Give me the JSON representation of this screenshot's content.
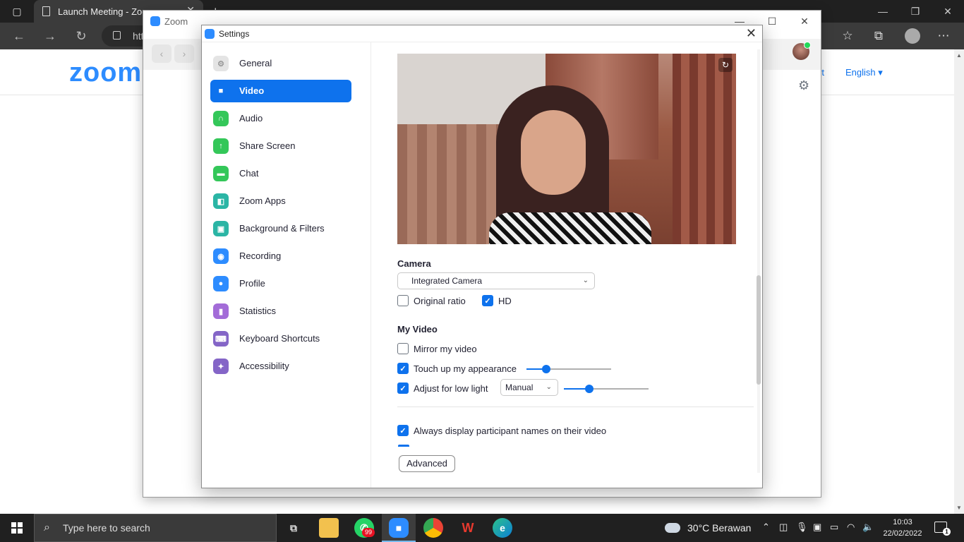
{
  "browser": {
    "tab_title": "Launch Meeting - Zoom",
    "address_text": "htt",
    "tab_close": "✕",
    "new_tab": "+"
  },
  "zoom_page": {
    "logo": "zoom",
    "support_link": "rt",
    "language_link": "English ▾"
  },
  "zoom_window": {
    "title": "Zoom",
    "nav_back": "‹",
    "nav_forward": "›"
  },
  "settings": {
    "title": "Settings",
    "close": "✕",
    "sidebar": [
      {
        "label": "General",
        "icon": "gear-icon",
        "color": "#e4e4e4",
        "glyph": "⚙",
        "active": false
      },
      {
        "label": "Video",
        "icon": "video-camera-icon",
        "color": "#0e72ed",
        "glyph": "■",
        "active": true
      },
      {
        "label": "Audio",
        "icon": "headphones-icon",
        "color": "#34c759",
        "glyph": "∩",
        "active": false
      },
      {
        "label": "Share Screen",
        "icon": "share-screen-icon",
        "color": "#34c759",
        "glyph": "↑",
        "active": false
      },
      {
        "label": "Chat",
        "icon": "chat-bubble-icon",
        "color": "#34c759",
        "glyph": "▬",
        "active": false
      },
      {
        "label": "Zoom Apps",
        "icon": "apps-icon",
        "color": "#2bb5a5",
        "glyph": "◧",
        "active": false
      },
      {
        "label": "Background & Filters",
        "icon": "background-icon",
        "color": "#2bb5a5",
        "glyph": "▣",
        "active": false
      },
      {
        "label": "Recording",
        "icon": "record-icon",
        "color": "#2d8cff",
        "glyph": "◉",
        "active": false
      },
      {
        "label": "Profile",
        "icon": "profile-icon",
        "color": "#2d8cff",
        "glyph": "●",
        "active": false
      },
      {
        "label": "Statistics",
        "icon": "statistics-icon",
        "color": "#a36cd8",
        "glyph": "▮",
        "active": false
      },
      {
        "label": "Keyboard Shortcuts",
        "icon": "keyboard-icon",
        "color": "#8465c7",
        "glyph": "⌨",
        "active": false
      },
      {
        "label": "Accessibility",
        "icon": "accessibility-icon",
        "color": "#8465c7",
        "glyph": "✦",
        "active": false
      }
    ],
    "camera_heading": "Camera",
    "camera_select": "Integrated Camera",
    "original_ratio": {
      "label": "Original ratio",
      "checked": false
    },
    "hd": {
      "label": "HD",
      "checked": true
    },
    "my_video_heading": "My Video",
    "mirror": {
      "label": "Mirror my video",
      "checked": false
    },
    "touch_up": {
      "label": "Touch up my appearance",
      "checked": true,
      "level": 0.23
    },
    "low_light": {
      "label": "Adjust for low light",
      "checked": true,
      "mode": "Manual",
      "level": 0.3
    },
    "display_names": {
      "label": "Always display participant names on their video",
      "checked": true
    },
    "advanced_button": "Advanced"
  },
  "taskbar": {
    "search_placeholder": "Type here to search",
    "whatsapp_badge": "99",
    "weather": "30°C  Berawan",
    "time": "10:03",
    "date": "22/02/2022",
    "notification_count": "1"
  }
}
